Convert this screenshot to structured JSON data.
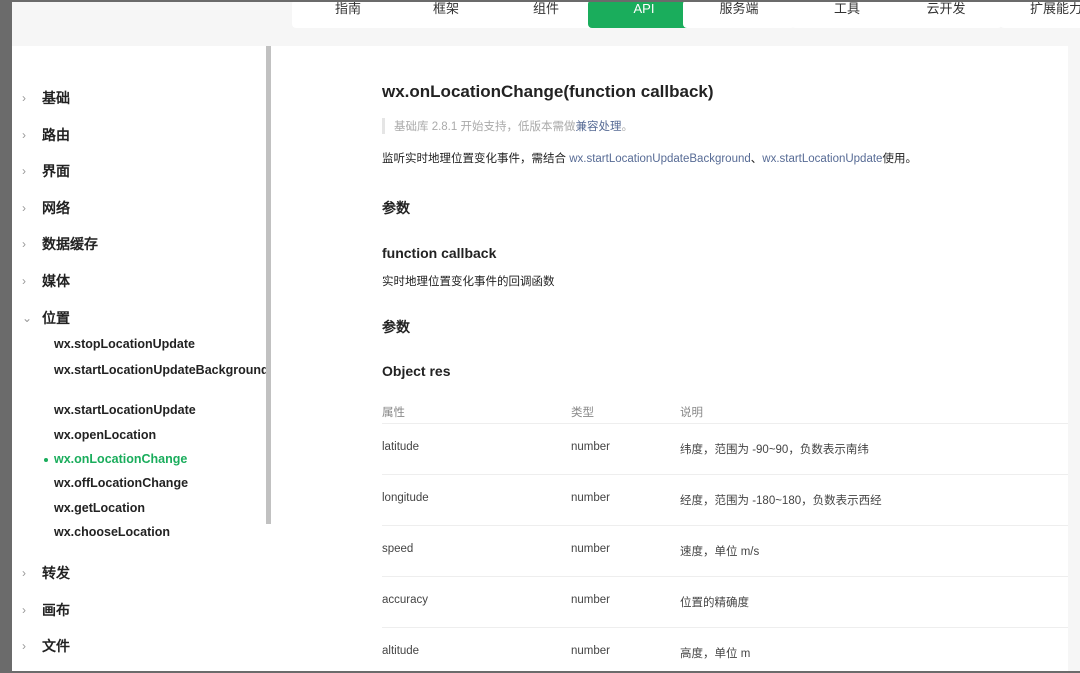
{
  "topnav": [
    "指南",
    "框架",
    "组件",
    "API",
    "服务端",
    "工具",
    "云开发",
    "扩展能力"
  ],
  "topnav_active": "API",
  "sidebar": {
    "categories_top": [
      "基础",
      "路由",
      "界面",
      "网络",
      "数据缓存",
      "媒体",
      "位置"
    ],
    "items": [
      "wx.stopLocationUpdate",
      "wx.startLocationUpdateBackground",
      "wx.startLocationUpdate",
      "wx.openLocation",
      "wx.onLocationChange",
      "wx.offLocationChange",
      "wx.getLocation",
      "wx.chooseLocation"
    ],
    "active_item": "wx.onLocationChange",
    "categories_bottom": [
      "转发",
      "画布",
      "文件"
    ]
  },
  "content": {
    "title": "wx.onLocationChange(function callback)",
    "note_prefix": "基础库 2.8.1 开始支持，低版本需做",
    "note_link": "兼容处理",
    "note_suffix": "。",
    "desc_prefix": "监听实时地理位置变化事件，需结合 ",
    "desc_link1": "wx.startLocationUpdateBackground",
    "desc_sep": "、",
    "desc_link2": "wx.startLocationUpdate",
    "desc_suffix": "使用。",
    "params_heading": "参数",
    "callback_heading": "function callback",
    "callback_desc": "实时地理位置变化事件的回调函数",
    "params_heading2": "参数",
    "object_heading": "Object res",
    "table": {
      "headers": [
        "属性",
        "类型",
        "说明"
      ],
      "rows": [
        [
          "latitude",
          "number",
          "纬度，范围为 -90~90，负数表示南纬"
        ],
        [
          "longitude",
          "number",
          "经度，范围为 -180~180，负数表示西经"
        ],
        [
          "speed",
          "number",
          "速度，单位 m/s"
        ],
        [
          "accuracy",
          "number",
          "位置的精确度"
        ],
        [
          "altitude",
          "number",
          "高度，单位 m"
        ]
      ]
    }
  }
}
